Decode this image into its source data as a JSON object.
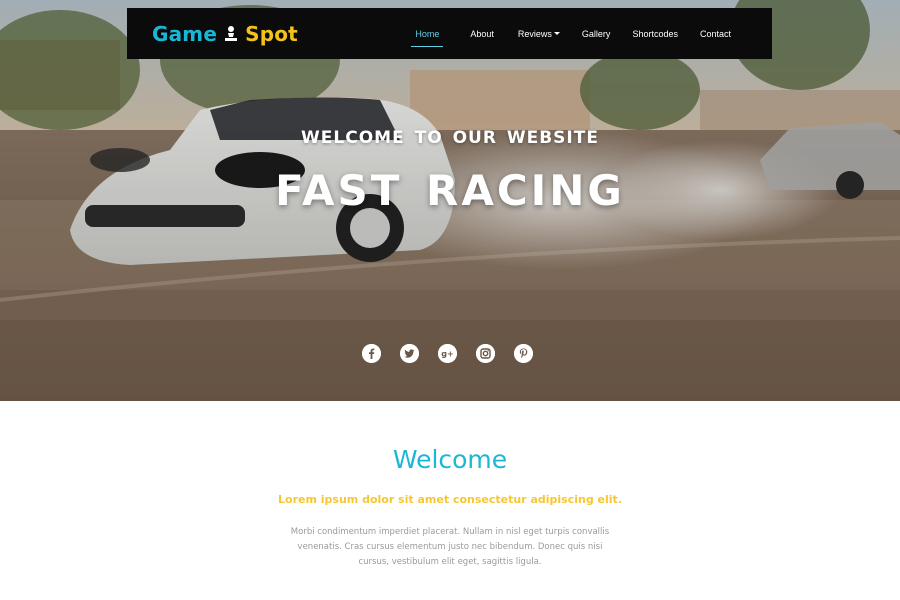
{
  "brand": {
    "word1": "Game",
    "word2": "Spot",
    "icon": "chess-pawn-icon",
    "colors": {
      "primary": "#19b7d6",
      "secondary": "#f2c21b"
    }
  },
  "nav": {
    "items": [
      {
        "label": "Home",
        "active": true
      },
      {
        "label": "About",
        "active": false
      },
      {
        "label": "Reviews",
        "active": false,
        "has_dropdown": true
      },
      {
        "label": "Gallery",
        "active": false
      },
      {
        "label": "Shortcodes",
        "active": false
      },
      {
        "label": "Contact",
        "active": false
      }
    ]
  },
  "hero": {
    "subtitle": "WELCOME TO OUR WEBSITE",
    "title": "FAST RACING",
    "social": [
      {
        "icon": "facebook-icon"
      },
      {
        "icon": "twitter-icon"
      },
      {
        "icon": "google-plus-icon"
      },
      {
        "icon": "instagram-icon"
      },
      {
        "icon": "pinterest-icon"
      }
    ]
  },
  "welcome": {
    "title": "Welcome",
    "lead": "Lorem ipsum dolor sit amet consectetur adipiscing elit.",
    "body": "Morbi condimentum imperdiet placerat. Nullam in nisl eget turpis convallis venenatis. Cras cursus elementum justo nec bibendum. Donec quis nisi cursus, vestibulum elit eget, sagittis ligula.",
    "colors": {
      "title": "#1db7d6",
      "lead": "#f7c733",
      "body": "#9a9a9a"
    }
  }
}
